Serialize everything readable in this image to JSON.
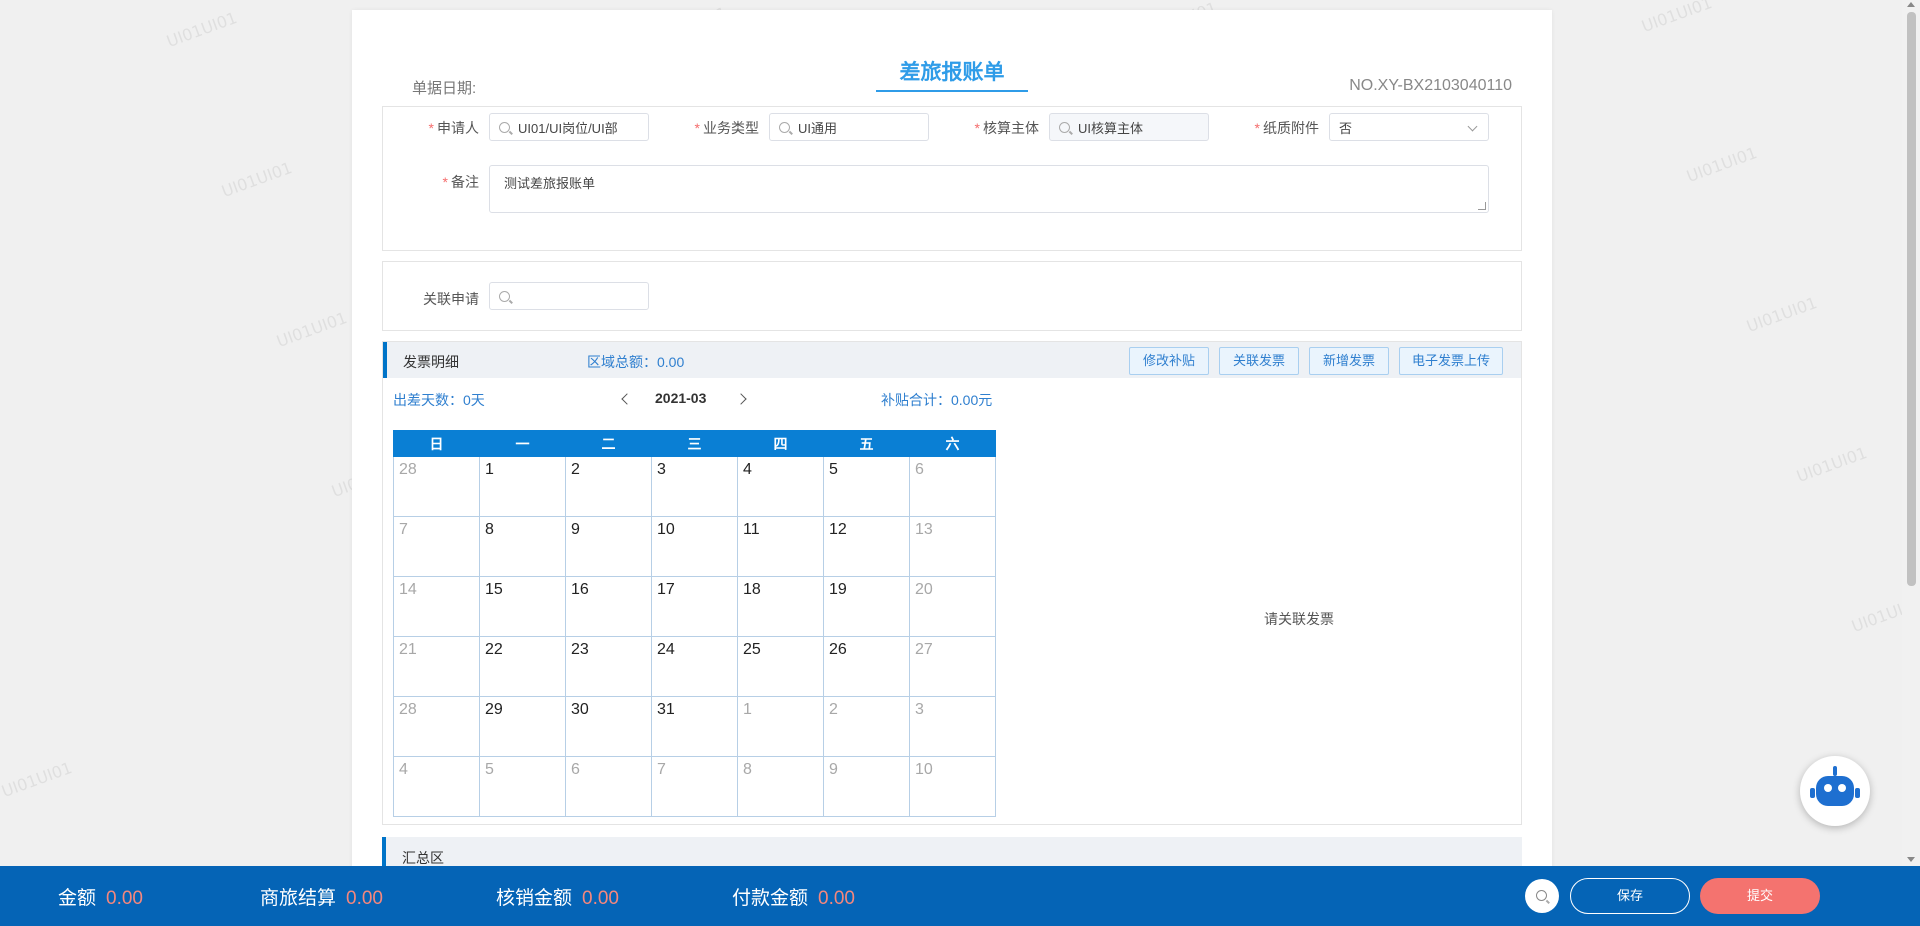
{
  "watermark_text": "UI01UI01",
  "document": {
    "title": "差旅报账单",
    "date_label": "单据日期:",
    "number": "NO.XY-BX2103040110"
  },
  "form": {
    "applicant": {
      "label": "申请人",
      "value": "UI01/UI岗位/UI部"
    },
    "business_type": {
      "label": "业务类型",
      "value": "UI通用"
    },
    "accounting_entity": {
      "label": "核算主体",
      "value": "UI核算主体"
    },
    "paper_attachment": {
      "label": "纸质附件",
      "value": "否"
    },
    "remark": {
      "label": "备注",
      "value": "测试差旅报账单"
    },
    "related_application": {
      "label": "关联申请",
      "value": ""
    }
  },
  "invoice": {
    "title": "发票明细",
    "region_total_label": "区域总额：0.00",
    "buttons": {
      "edit_subsidy": "修改补贴",
      "link_invoice": "关联发票",
      "add_invoice": "新增发票",
      "upload_einvoice": "电子发票上传"
    },
    "trip_days": "出差天数：0天",
    "month": "2021-03",
    "subsidy_total": "补贴合计：0.00元",
    "empty_hint": "请关联发票"
  },
  "calendar": {
    "weekdays": [
      "日",
      "一",
      "二",
      "三",
      "四",
      "五",
      "六"
    ],
    "weeks": [
      [
        {
          "d": "28",
          "o": true
        },
        {
          "d": "1"
        },
        {
          "d": "2"
        },
        {
          "d": "3"
        },
        {
          "d": "4"
        },
        {
          "d": "5"
        },
        {
          "d": "6",
          "o": true
        }
      ],
      [
        {
          "d": "7",
          "o": true
        },
        {
          "d": "8"
        },
        {
          "d": "9"
        },
        {
          "d": "10"
        },
        {
          "d": "11"
        },
        {
          "d": "12"
        },
        {
          "d": "13",
          "o": true
        }
      ],
      [
        {
          "d": "14",
          "o": true
        },
        {
          "d": "15"
        },
        {
          "d": "16"
        },
        {
          "d": "17"
        },
        {
          "d": "18"
        },
        {
          "d": "19"
        },
        {
          "d": "20",
          "o": true
        }
      ],
      [
        {
          "d": "21",
          "o": true
        },
        {
          "d": "22"
        },
        {
          "d": "23"
        },
        {
          "d": "24"
        },
        {
          "d": "25"
        },
        {
          "d": "26"
        },
        {
          "d": "27",
          "o": true
        }
      ],
      [
        {
          "d": "28",
          "o": true
        },
        {
          "d": "29"
        },
        {
          "d": "30"
        },
        {
          "d": "31"
        },
        {
          "d": "1",
          "o": true
        },
        {
          "d": "2",
          "o": true
        },
        {
          "d": "3",
          "o": true
        }
      ],
      [
        {
          "d": "4",
          "o": true
        },
        {
          "d": "5",
          "o": true
        },
        {
          "d": "6",
          "o": true
        },
        {
          "d": "7",
          "o": true
        },
        {
          "d": "8",
          "o": true
        },
        {
          "d": "9",
          "o": true
        },
        {
          "d": "10",
          "o": true
        }
      ]
    ]
  },
  "summary": {
    "title": "汇总区"
  },
  "footer": {
    "amount": {
      "label": "金额",
      "value": "0.00"
    },
    "travel_settlement": {
      "label": "商旅结算",
      "value": "0.00"
    },
    "writeoff_amount": {
      "label": "核销金额",
      "value": "0.00"
    },
    "payment_amount": {
      "label": "付款金额",
      "value": "0.00"
    },
    "save_label": "保存",
    "submit_label": "提交"
  },
  "icons": {
    "search": "search-icon",
    "chevron": "chevron-down-icon",
    "robot": "robot-assistant-icon"
  },
  "colors": {
    "accent": "#0564b6",
    "title_blue": "#2f9ce8",
    "submit": "#f4736f",
    "value_red": "#f5877d"
  }
}
